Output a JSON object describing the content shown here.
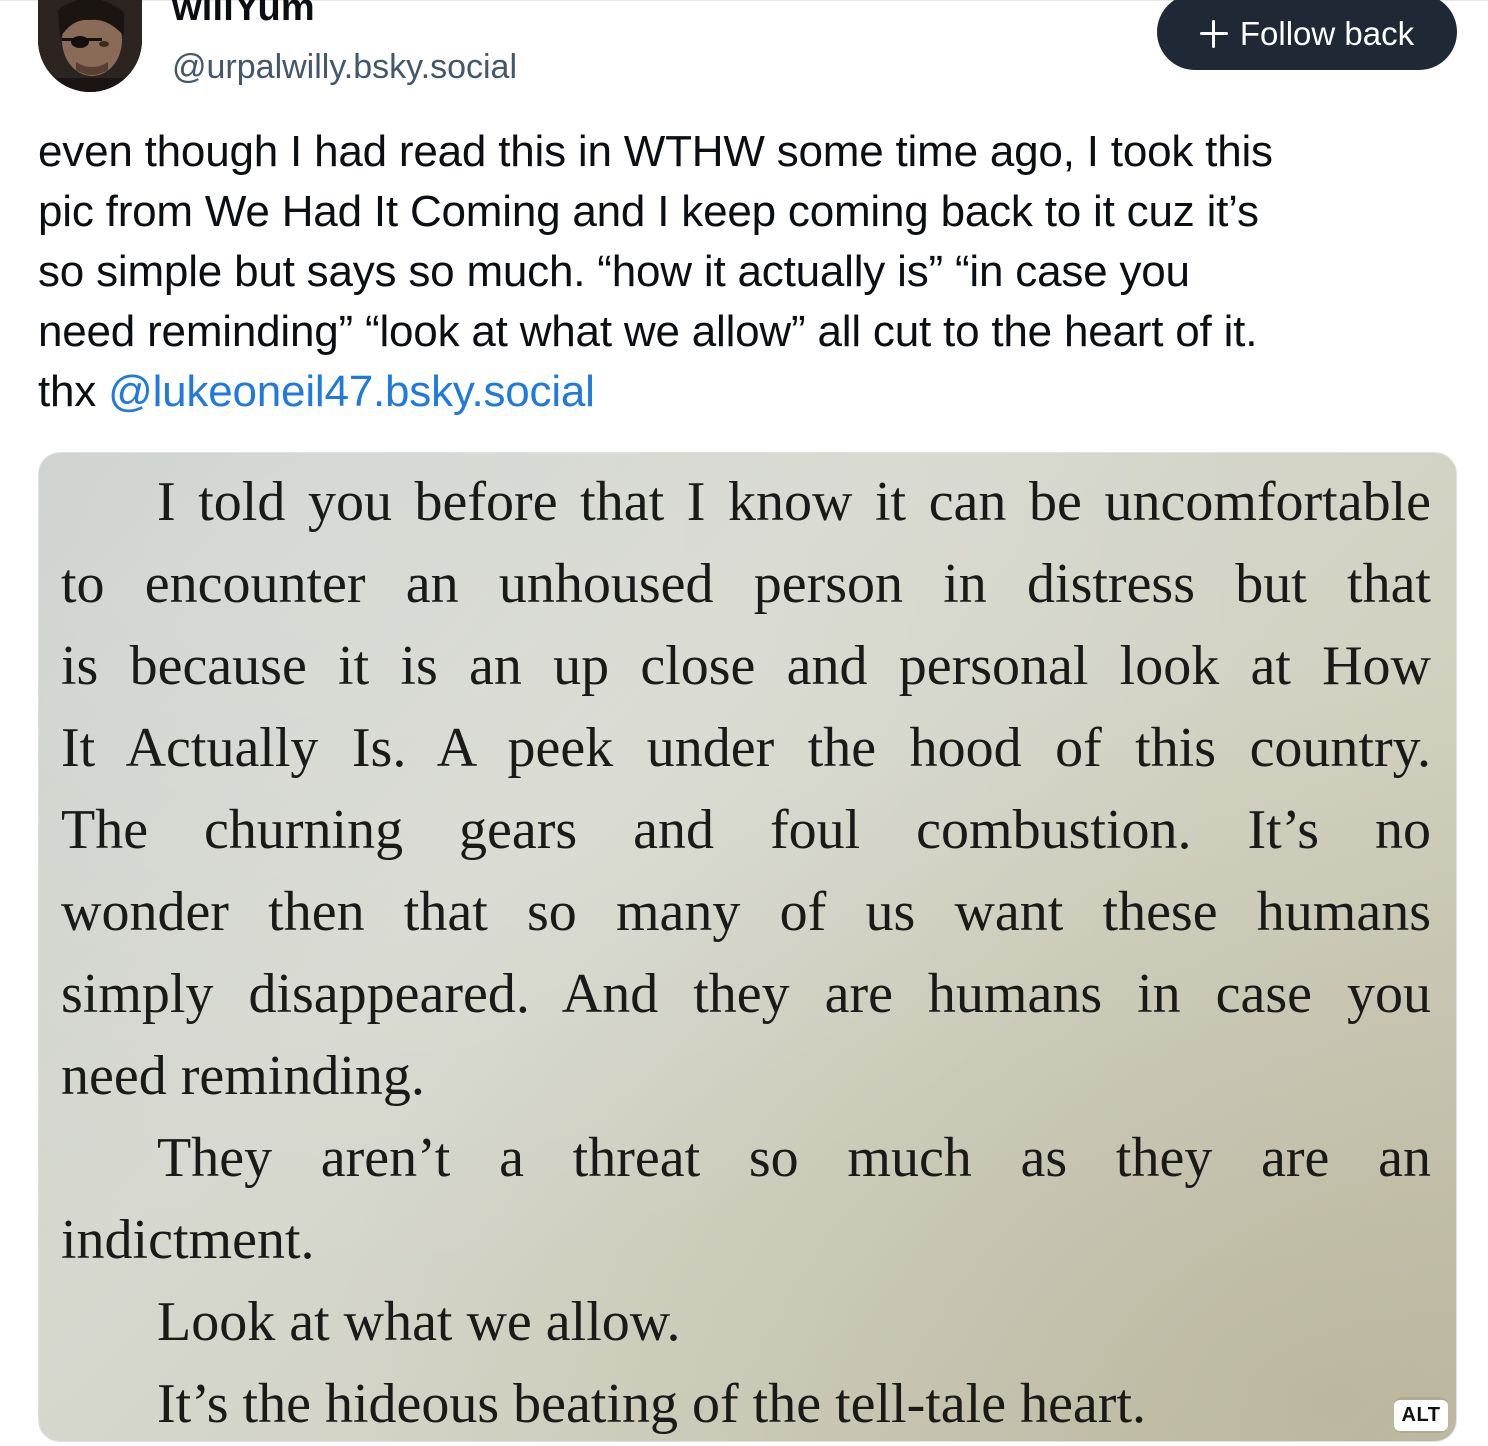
{
  "author": {
    "display_name": "willYum",
    "handle": "@urpalwilly.bsky.social",
    "avatar_icon": "profile-photo-avatar"
  },
  "follow_button": {
    "label": "Follow back",
    "icon": "plus-icon",
    "bg_color": "#1e2935"
  },
  "post": {
    "lines": [
      "even though I had read this in WTHW some time ago, I took this",
      "pic from We Had It Coming and I keep coming back to it cuz it’s",
      "so simple but says so much. “how it actually is” “in case you",
      "need reminding” “look at what we allow” all cut to the heart of it."
    ],
    "last_line_prefix": "thx ",
    "mention": "@lukeoneil47.bsky.social",
    "mention_color": "#1f7ae0"
  },
  "image": {
    "book_lines": [
      "I told you before that I know it can be uncomfortable",
      "to encounter an unhoused person in distress but that",
      "is because it is an up close and personal look at How",
      "It Actually Is. A peek under the hood of this country.",
      "The churning gears and foul combustion. It’s no",
      "wonder then that so many of us want these humans",
      "simply disappeared. And they are humans in case you",
      "need reminding.",
      "They aren’t a threat so much as they are an",
      "indictment.",
      "Look at what we allow.",
      "It’s the hideous beating of the tell-tale heart."
    ],
    "alt_badge": "ALT"
  }
}
